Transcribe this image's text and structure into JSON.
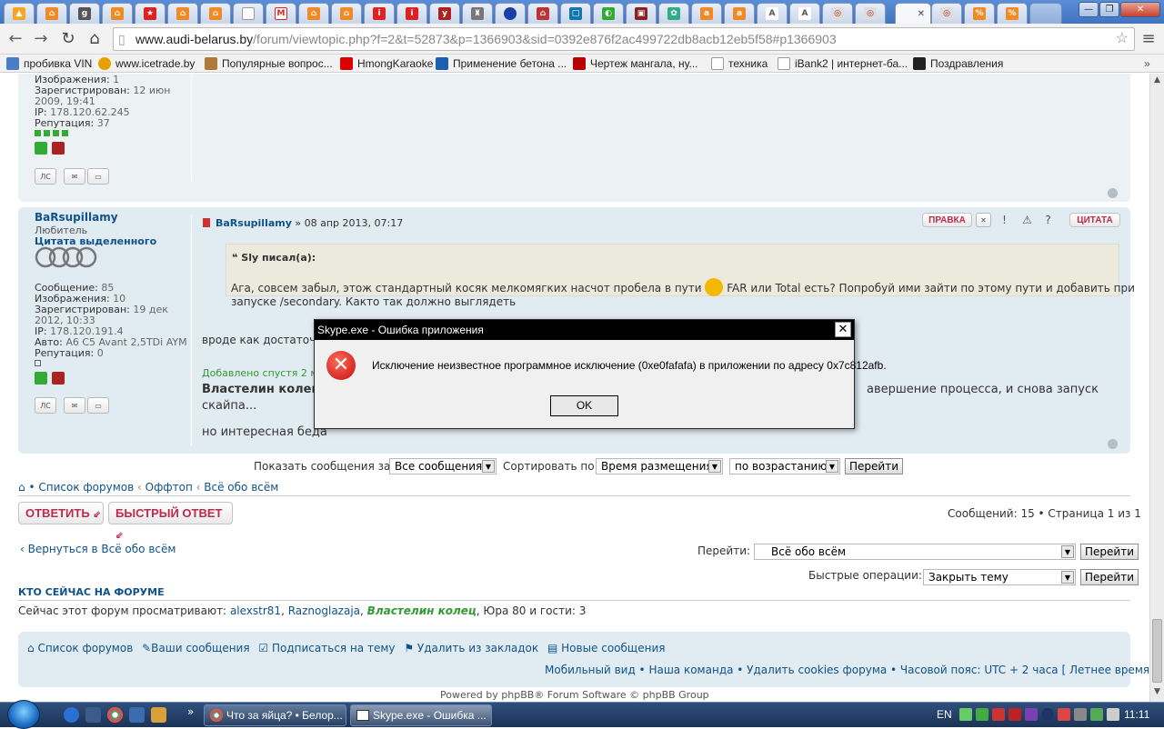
{
  "browser": {
    "active_tab_close": "✕",
    "url_host": "www.audi-belarus.by",
    "url_path": "/forum/viewtopic.php?f=2&t=52873&p=1366903&sid=0392e876f2ac499722db8acb12eb5f58#p1366903",
    "bookmarks": [
      "пробивка VIN",
      "www.icetrade.by",
      "Популярные вопрос...",
      "HmongKaraoke",
      "Применение бетона ...",
      "Чертеж мангала, ну...",
      "техника",
      "iBank2 | интернет-ба...",
      "Поздравления"
    ]
  },
  "post1": {
    "images_label": "Изображения:",
    "images_value": "1",
    "registered_label": "Зарегистрирован:",
    "registered_value_1": "12 июн",
    "registered_value_2": "2009, 19:41",
    "ip_label": "IP:",
    "ip_value": "178.120.62.245",
    "rep_label": "Репутация:",
    "rep_value": "37"
  },
  "post2": {
    "author": "BaRsupillamy",
    "rank": "Любитель",
    "rank2": "Цитата выделенного",
    "posts_label": "Сообщение:",
    "posts_value": "85",
    "images_label": "Изображения:",
    "images_value": "10",
    "registered_label": "Зарегистрирован:",
    "registered_value_1": "19 дек",
    "registered_value_2": "2012, 10:33",
    "ip_label": "IP:",
    "ip_value": "178.120.191.4",
    "auto_label": "Авто:",
    "auto_value": "A6 C5 Avant 2,5TDi AYM",
    "rep_label": "Репутация:",
    "rep_value": "0",
    "head_author": "BaRsupillamy",
    "head_date": "» 08 апр 2013, 07:17",
    "btn_edit": "ПРАВКА",
    "btn_quote": "ЦИТАТА",
    "quote_author": "Sly писал(а):",
    "quote_line1_a": "Ага, совсем забыл, этож стандартный косяк мелкомягких насчот пробела в пути",
    "quote_line1_b": "FAR или Total есть? Попробуй ими зайти по этому пути и добавить при",
    "quote_line2": "запуске /secondary. Както так должно выглядеть",
    "body1": "вроде как достаточ",
    "added_label": "Добавлено спустя 2 ми",
    "body2_bold": "Властелин колец,",
    "body2_tail": "авершение процесса, и снова запуск",
    "body3": "скайпа...",
    "body4": "но интересная беда"
  },
  "sort": {
    "show_label": "Показать сообщения за:",
    "show_value": "Все сообщения",
    "sort_label": "Сортировать по:",
    "sort_value": "Время размещения",
    "order_value": "по возрастанию",
    "go": "Перейти"
  },
  "breadcrumb": [
    "Список форумов",
    "Оффтоп",
    "Всё обо всём"
  ],
  "actions": {
    "reply": "ОТВЕТИТЬ",
    "quick_reply": "БЫСТРЫЙ ОТВЕТ",
    "pagination": "Сообщений: 15 • Страница 1 из 1",
    "back": "Вернуться в Всё обо всём",
    "jump_label": "Перейти:",
    "jump_value": "Всё обо всём",
    "jump_go": "Перейти",
    "quick_label": "Быстрые операции:",
    "quick_value": "Закрыть тему",
    "quick_go": "Перейти"
  },
  "online": {
    "heading": "КТО СЕЙЧАС НА ФОРУМЕ",
    "prefix": "Сейчас этот форум просматривают:",
    "user1": "alexstr81",
    "user2": "Raznoglazaja",
    "user3": "Властелин колец",
    "suffix": ", Юра 80 и гости: 3"
  },
  "footer": {
    "links": [
      "Список форумов",
      "Ваши сообщения",
      "Подписаться на тему",
      "Удалить из закладок",
      "Новые сообщения"
    ],
    "line2": "Мобильный вид • Наша команда • Удалить cookies форума • Часовой пояс: UTC + 2 часа [ Летнее время ]",
    "powered": "Powered by phpBB® Forum Software © phpBB Group"
  },
  "dialog": {
    "title": "Skype.exe - Ошибка приложения",
    "close": "✕",
    "icon": "✕",
    "message": "Исключение неизвестное программное исключение (0xe0fafafa) в приложении по адресу 0x7c812afb.",
    "ok": "OK"
  },
  "taskbar": {
    "task1": "Что за яйца? • Белор...",
    "task2": "Skype.exe - Ошибка ...",
    "lang": "EN",
    "clock": "11:11"
  }
}
